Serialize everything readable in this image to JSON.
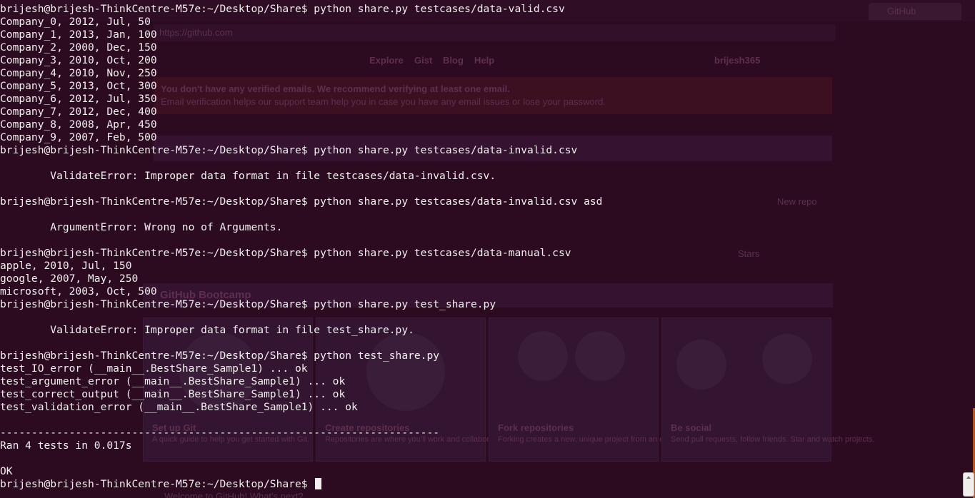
{
  "background": {
    "browser_tab": "GitHub",
    "address_bar": "https://github.com",
    "nav_items": [
      "Explore",
      "Gist",
      "Blog",
      "Help"
    ],
    "username": "brijesh365",
    "notice_line1": "You don't have any verified emails. We recommend verifying at least one email.",
    "notice_line2": "Email verification helps our support team help you in case you have any email issues or lose your password.",
    "bootcamp_title": "GitHub Bootcamp",
    "cards": [
      {
        "title": "Set up Git",
        "text": "A quick guide to help you get started with Git."
      },
      {
        "title": "Create repositories",
        "text": "Repositories are where you'll work and collaborate on projects."
      },
      {
        "title": "Fork repositories",
        "text": "Forking creates a new, unique project from an existing one."
      },
      {
        "title": "Be social",
        "text": "Send pull requests, follow friends. Star and watch projects."
      }
    ],
    "footer_text": "Welcome to GitHub! What's next?",
    "sidebar_new_repo": "New repo",
    "sidebar_stars": "Stars"
  },
  "terminal": {
    "lines": [
      "brijesh@brijesh-ThinkCentre-M57e:~/Desktop/Share$ python share.py testcases/data-valid.csv",
      "Company_0, 2012, Jul, 50",
      "Company_1, 2013, Jan, 100",
      "Company_2, 2000, Dec, 150",
      "Company_3, 2010, Oct, 200",
      "Company_4, 2010, Nov, 250",
      "Company_5, 2013, Oct, 300",
      "Company_6, 2012, Jul, 350",
      "Company_7, 2012, Dec, 400",
      "Company_8, 2008, Apr, 450",
      "Company_9, 2007, Feb, 500",
      "brijesh@brijesh-ThinkCentre-M57e:~/Desktop/Share$ python share.py testcases/data-invalid.csv",
      "",
      "        ValidateError: Improper data format in file testcases/data-invalid.csv.",
      "",
      "brijesh@brijesh-ThinkCentre-M57e:~/Desktop/Share$ python share.py testcases/data-invalid.csv asd",
      "",
      "        ArgumentError: Wrong no of Arguments.",
      "",
      "brijesh@brijesh-ThinkCentre-M57e:~/Desktop/Share$ python share.py testcases/data-manual.csv",
      "apple, 2010, Jul, 150",
      "google, 2007, May, 250",
      "microsoft, 2003, Oct, 500",
      "brijesh@brijesh-ThinkCentre-M57e:~/Desktop/Share$ python share.py test_share.py",
      "",
      "        ValidateError: Improper data format in file test_share.py.",
      "",
      "brijesh@brijesh-ThinkCentre-M57e:~/Desktop/Share$ python test_share.py",
      "test_IO_error (__main__.BestShare_Sample1) ... ok",
      "test_argument_error (__main__.BestShare_Sample1) ... ok",
      "test_correct_output (__main__.BestShare_Sample1) ... ok",
      "test_validation_error (__main__.BestShare_Sample1) ... ok",
      "",
      "----------------------------------------------------------------------",
      "Ran 4 tests in 0.017s",
      "",
      "OK"
    ],
    "prompt": "brijesh@brijesh-ThinkCentre-M57e:~/Desktop/Share$ ",
    "colors": {
      "background": "#2c0b21",
      "foreground": "#f2f0ee"
    }
  }
}
